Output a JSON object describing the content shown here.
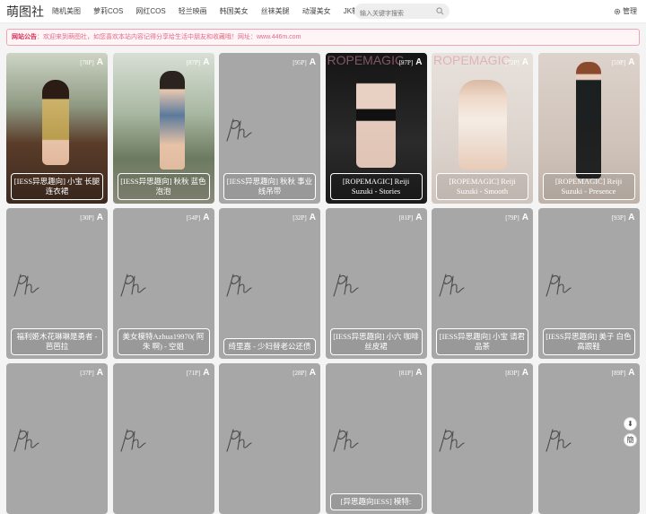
{
  "header": {
    "logo": "萌图社",
    "nav": [
      "随机美图",
      "萝莉COS",
      "网红COS",
      "轻兰映画",
      "韩国美女",
      "丝袜美腿",
      "动漫美女",
      "JK制服"
    ],
    "search_placeholder": "输入关键字搜索",
    "admin_label": "管理"
  },
  "notice": {
    "label": "网站公告",
    "text": "：欢迎来到萌图社，如您喜欢本站内容记得分享给生活中朋友和收藏哦！网址：www.446m.com"
  },
  "cards": [
    {
      "count": "[78P]",
      "badge": "A",
      "caption": "[IESS异思趣向] 小宝 长腿连衣裙",
      "kind": "photo1",
      "overlay": ""
    },
    {
      "count": "[87P]",
      "badge": "A",
      "caption": "[IESS异思趣向] 秋秋 蓝色泡泡",
      "kind": "photo2",
      "overlay": ""
    },
    {
      "count": "[95P]",
      "badge": "A",
      "caption": "[IESS异思趣向] 秋秋 事业线吊带",
      "kind": "placeholder",
      "overlay": ""
    },
    {
      "count": "[97P]",
      "badge": "A",
      "caption": "[ROPEMAGIC] Reiji Suzuki - Stories",
      "kind": "photo3",
      "overlay": "ROPEMAGIC"
    },
    {
      "count": "[72P]",
      "badge": "A",
      "caption": "[ROPEMAGIC] Reiji Suzuki - Smooth",
      "kind": "photo4",
      "overlay": "ROPEMAGIC"
    },
    {
      "count": "[59P]",
      "badge": "A",
      "caption": "[ROPEMAGIC] Reiji Suzuki - Presence",
      "kind": "photo5",
      "overlay": ""
    },
    {
      "count": "[30P]",
      "badge": "A",
      "caption": "福利姬木花琳琳是勇者 - 芭芭拉",
      "kind": "placeholder",
      "overlay": ""
    },
    {
      "count": "[54P]",
      "badge": "A",
      "caption": "美女模特Azhua19970( 阿朱 啊) - 空姐",
      "kind": "placeholder",
      "overlay": ""
    },
    {
      "count": "[32P]",
      "badge": "A",
      "caption": "绮里嘉 - 少妇替老公还债",
      "kind": "placeholder",
      "overlay": ""
    },
    {
      "count": "[81P]",
      "badge": "A",
      "caption": "[IESS异思趣向] 小六 咖啡丝皮裙",
      "kind": "placeholder",
      "overlay": ""
    },
    {
      "count": "[79P]",
      "badge": "A",
      "caption": "[IESS异思趣向] 小宝 请君品茶",
      "kind": "placeholder",
      "overlay": ""
    },
    {
      "count": "[93P]",
      "badge": "A",
      "caption": "[IESS异思趣向] 美子 白色高跟鞋",
      "kind": "placeholder",
      "overlay": ""
    },
    {
      "count": "[37P]",
      "badge": "A",
      "caption": "",
      "kind": "placeholder",
      "overlay": ""
    },
    {
      "count": "[71P]",
      "badge": "A",
      "caption": "",
      "kind": "placeholder",
      "overlay": ""
    },
    {
      "count": "[28P]",
      "badge": "A",
      "caption": "",
      "kind": "placeholder",
      "overlay": ""
    },
    {
      "count": "[81P]",
      "badge": "A",
      "caption": "[异思趣向IESS] 模特:",
      "kind": "placeholder",
      "overlay": ""
    },
    {
      "count": "[83P]",
      "badge": "A",
      "caption": "",
      "kind": "placeholder",
      "overlay": ""
    },
    {
      "count": "[89P]",
      "badge": "A",
      "caption": "",
      "kind": "placeholder",
      "overlay": ""
    }
  ],
  "float_buttons": {
    "down": "⬇",
    "lang": "簡"
  },
  "colors": {
    "accent": "#d92f58",
    "notice_bg": "#fff5f7",
    "placeholder": "#a7a7a7"
  }
}
